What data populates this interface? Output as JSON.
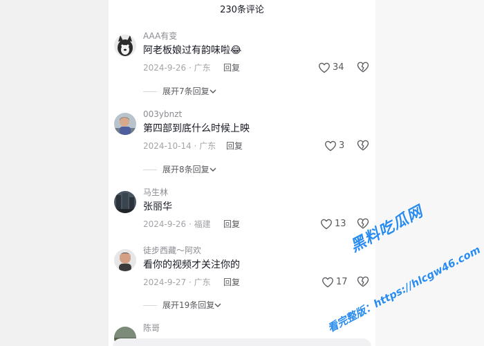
{
  "header": {
    "title": "230条评论"
  },
  "comments": [
    {
      "user": "AAA有变",
      "text": "阿老板娘过有韵味啦😂",
      "date": "2024-9-26",
      "location": "广东",
      "reply": "回复",
      "likes": "34",
      "expand": "展开7条回复"
    },
    {
      "user": "003ybnzt",
      "text": "第四部到底什么时候上映",
      "date": "2024-10-14",
      "location": "广东",
      "reply": "回复",
      "likes": "3",
      "expand": "展开8条回复"
    },
    {
      "user": "马生林",
      "text": "张丽华",
      "date": "2024-9-26",
      "location": "福建",
      "reply": "回复",
      "likes": "13"
    },
    {
      "user": "徒步西藏～阿欢",
      "text": "看你的视频才关注你的",
      "date": "2024-9-27",
      "location": "广东",
      "reply": "回复",
      "likes": "17",
      "expand": "展开19条回复"
    },
    {
      "user": "陈哥"
    }
  ],
  "watermark": {
    "line1": "黑料吃瓜网",
    "line2": "看完整版：https://hlcgw46.com"
  },
  "colors": {
    "accent": "#2a8cf0",
    "meta": "#a3a4a8",
    "text": "#161823"
  }
}
